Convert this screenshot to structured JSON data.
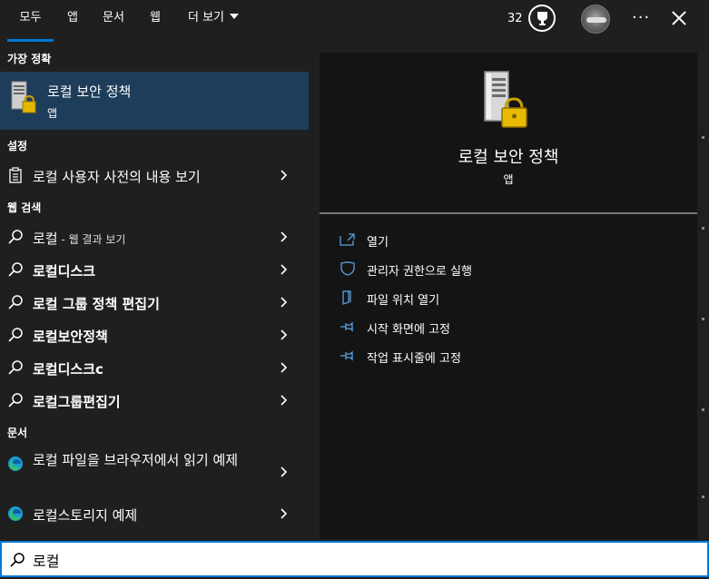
{
  "tabs": [
    {
      "label": "모두"
    },
    {
      "label": "앱"
    },
    {
      "label": "문서"
    },
    {
      "label": "웹"
    },
    {
      "label": "더 보기"
    }
  ],
  "header": {
    "points": "32"
  },
  "sections": {
    "best": "가장 정확",
    "settings": "설정",
    "web": "웹 검색",
    "docs": "문서"
  },
  "best_match": {
    "title": "로컬 보안 정책",
    "subtitle": "앱"
  },
  "settings_items": [
    {
      "label": "로컬 사용자 사전의 내용 보기"
    }
  ],
  "web_items": [
    {
      "label": "로컬",
      "suffix": " - 웹 결과 보기"
    },
    {
      "label": "로컬디스크"
    },
    {
      "label": "로컬 그룹 정책 편집기"
    },
    {
      "label": "로컬보안정책"
    },
    {
      "label": "로컬디스크c"
    },
    {
      "label": "로컬그룹편집기"
    }
  ],
  "doc_items": [
    {
      "label": "로컬 파일을 브라우저에서 읽기 예제"
    },
    {
      "label": "로컬스토리지 예제"
    }
  ],
  "detail": {
    "title": "로컬 보안 정책",
    "subtitle": "앱",
    "actions": [
      {
        "label": "열기",
        "icon": "open-icon"
      },
      {
        "label": "관리자 권한으로 실행",
        "icon": "shield-icon"
      },
      {
        "label": "파일 위치 열기",
        "icon": "folder-icon"
      },
      {
        "label": "시작 화면에 고정",
        "icon": "pin-icon"
      },
      {
        "label": "작업 표시줄에 고정",
        "icon": "pin-icon"
      }
    ]
  },
  "search": {
    "value": "로컬"
  },
  "colors": {
    "accent": "#0078d4",
    "selected": "#1d3d5a",
    "background": "#1f1f1f",
    "detail_bg": "#141414"
  }
}
